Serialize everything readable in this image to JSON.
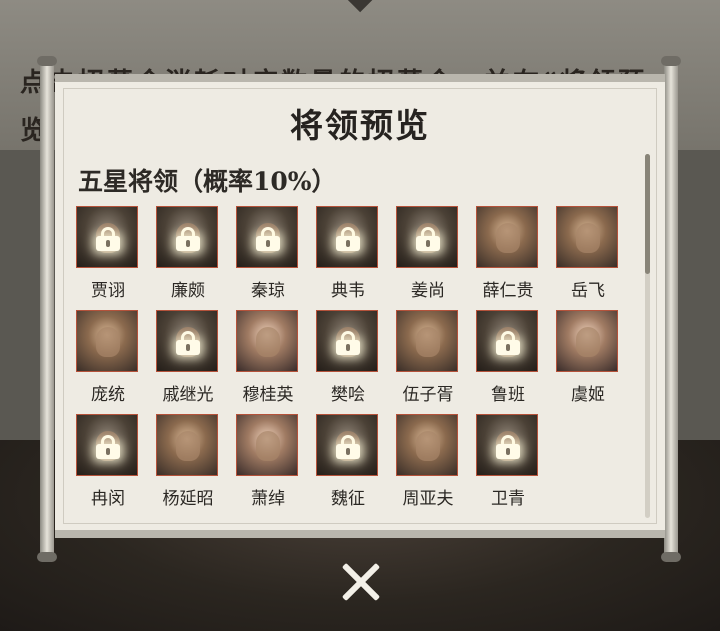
{
  "background_text": {
    "line1": "点击招募令消耗对应数量的招募令，并在“将领预",
    "line2": "览"
  },
  "dialog": {
    "title": "将领预览",
    "section_title": "五星将领（概率10%）"
  },
  "generals": [
    {
      "name": "贾诩",
      "locked": true
    },
    {
      "name": "廉颇",
      "locked": true
    },
    {
      "name": "秦琼",
      "locked": true
    },
    {
      "name": "典韦",
      "locked": true
    },
    {
      "name": "姜尚",
      "locked": true
    },
    {
      "name": "薛仁贵",
      "locked": false
    },
    {
      "name": "岳飞",
      "locked": false
    },
    {
      "name": "庞统",
      "locked": false
    },
    {
      "name": "戚继光",
      "locked": true
    },
    {
      "name": "穆桂英",
      "locked": false
    },
    {
      "name": "樊哙",
      "locked": true
    },
    {
      "name": "伍子胥",
      "locked": false
    },
    {
      "name": "鲁班",
      "locked": true
    },
    {
      "name": "虞姬",
      "locked": false
    },
    {
      "name": "冉闵",
      "locked": true
    },
    {
      "name": "杨延昭",
      "locked": false
    },
    {
      "name": "萧绰",
      "locked": false
    },
    {
      "name": "魏征",
      "locked": true
    },
    {
      "name": "周亚夫",
      "locked": false
    },
    {
      "name": "卫青",
      "locked": true
    }
  ],
  "colors": {
    "portrait_border": "#b5523a",
    "panel": "#eeebe3"
  },
  "icons": {
    "lock": "lock-icon",
    "close": "close-icon"
  }
}
